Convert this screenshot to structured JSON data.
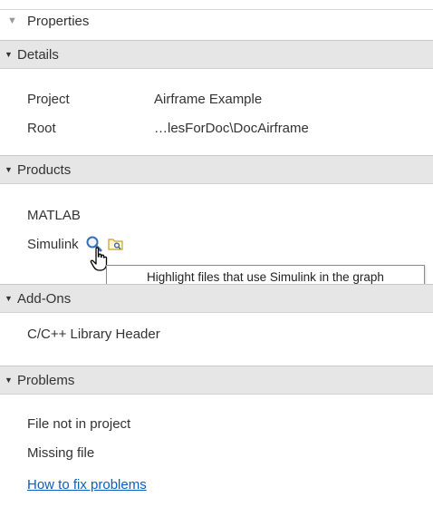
{
  "panel": {
    "title": "Properties"
  },
  "sections": {
    "details": {
      "label": "Details",
      "rows": [
        {
          "key": "Project",
          "value": "Airframe Example"
        },
        {
          "key": "Root",
          "value": "…lesForDoc\\DocAirframe"
        }
      ]
    },
    "products": {
      "label": "Products",
      "items": [
        "MATLAB",
        "Simulink"
      ]
    },
    "addons": {
      "label": "Add-Ons",
      "items": [
        "C/C++ Library Header"
      ]
    },
    "problems": {
      "label": "Problems",
      "items": [
        "File not in project",
        "Missing file"
      ],
      "help_link": "How to fix problems"
    }
  },
  "tooltip": {
    "text": "Highlight files that use Simulink in the graph"
  },
  "icons": {
    "highlight": "magnifier-icon",
    "open_folder": "folder-search-icon"
  }
}
